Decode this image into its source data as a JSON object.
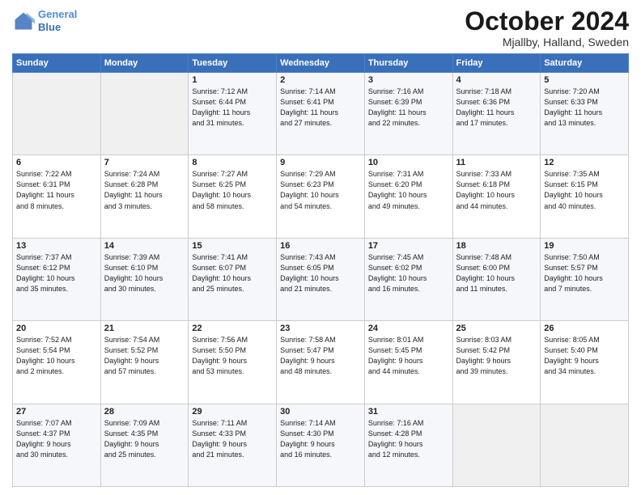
{
  "header": {
    "logo_line1": "General",
    "logo_line2": "Blue",
    "month_title": "October 2024",
    "location": "Mjallby, Halland, Sweden"
  },
  "days_of_week": [
    "Sunday",
    "Monday",
    "Tuesday",
    "Wednesday",
    "Thursday",
    "Friday",
    "Saturday"
  ],
  "weeks": [
    [
      {
        "num": "",
        "info": ""
      },
      {
        "num": "",
        "info": ""
      },
      {
        "num": "1",
        "info": "Sunrise: 7:12 AM\nSunset: 6:44 PM\nDaylight: 11 hours\nand 31 minutes."
      },
      {
        "num": "2",
        "info": "Sunrise: 7:14 AM\nSunset: 6:41 PM\nDaylight: 11 hours\nand 27 minutes."
      },
      {
        "num": "3",
        "info": "Sunrise: 7:16 AM\nSunset: 6:39 PM\nDaylight: 11 hours\nand 22 minutes."
      },
      {
        "num": "4",
        "info": "Sunrise: 7:18 AM\nSunset: 6:36 PM\nDaylight: 11 hours\nand 17 minutes."
      },
      {
        "num": "5",
        "info": "Sunrise: 7:20 AM\nSunset: 6:33 PM\nDaylight: 11 hours\nand 13 minutes."
      }
    ],
    [
      {
        "num": "6",
        "info": "Sunrise: 7:22 AM\nSunset: 6:31 PM\nDaylight: 11 hours\nand 8 minutes."
      },
      {
        "num": "7",
        "info": "Sunrise: 7:24 AM\nSunset: 6:28 PM\nDaylight: 11 hours\nand 3 minutes."
      },
      {
        "num": "8",
        "info": "Sunrise: 7:27 AM\nSunset: 6:25 PM\nDaylight: 10 hours\nand 58 minutes."
      },
      {
        "num": "9",
        "info": "Sunrise: 7:29 AM\nSunset: 6:23 PM\nDaylight: 10 hours\nand 54 minutes."
      },
      {
        "num": "10",
        "info": "Sunrise: 7:31 AM\nSunset: 6:20 PM\nDaylight: 10 hours\nand 49 minutes."
      },
      {
        "num": "11",
        "info": "Sunrise: 7:33 AM\nSunset: 6:18 PM\nDaylight: 10 hours\nand 44 minutes."
      },
      {
        "num": "12",
        "info": "Sunrise: 7:35 AM\nSunset: 6:15 PM\nDaylight: 10 hours\nand 40 minutes."
      }
    ],
    [
      {
        "num": "13",
        "info": "Sunrise: 7:37 AM\nSunset: 6:12 PM\nDaylight: 10 hours\nand 35 minutes."
      },
      {
        "num": "14",
        "info": "Sunrise: 7:39 AM\nSunset: 6:10 PM\nDaylight: 10 hours\nand 30 minutes."
      },
      {
        "num": "15",
        "info": "Sunrise: 7:41 AM\nSunset: 6:07 PM\nDaylight: 10 hours\nand 25 minutes."
      },
      {
        "num": "16",
        "info": "Sunrise: 7:43 AM\nSunset: 6:05 PM\nDaylight: 10 hours\nand 21 minutes."
      },
      {
        "num": "17",
        "info": "Sunrise: 7:45 AM\nSunset: 6:02 PM\nDaylight: 10 hours\nand 16 minutes."
      },
      {
        "num": "18",
        "info": "Sunrise: 7:48 AM\nSunset: 6:00 PM\nDaylight: 10 hours\nand 11 minutes."
      },
      {
        "num": "19",
        "info": "Sunrise: 7:50 AM\nSunset: 5:57 PM\nDaylight: 10 hours\nand 7 minutes."
      }
    ],
    [
      {
        "num": "20",
        "info": "Sunrise: 7:52 AM\nSunset: 5:54 PM\nDaylight: 10 hours\nand 2 minutes."
      },
      {
        "num": "21",
        "info": "Sunrise: 7:54 AM\nSunset: 5:52 PM\nDaylight: 9 hours\nand 57 minutes."
      },
      {
        "num": "22",
        "info": "Sunrise: 7:56 AM\nSunset: 5:50 PM\nDaylight: 9 hours\nand 53 minutes."
      },
      {
        "num": "23",
        "info": "Sunrise: 7:58 AM\nSunset: 5:47 PM\nDaylight: 9 hours\nand 48 minutes."
      },
      {
        "num": "24",
        "info": "Sunrise: 8:01 AM\nSunset: 5:45 PM\nDaylight: 9 hours\nand 44 minutes."
      },
      {
        "num": "25",
        "info": "Sunrise: 8:03 AM\nSunset: 5:42 PM\nDaylight: 9 hours\nand 39 minutes."
      },
      {
        "num": "26",
        "info": "Sunrise: 8:05 AM\nSunset: 5:40 PM\nDaylight: 9 hours\nand 34 minutes."
      }
    ],
    [
      {
        "num": "27",
        "info": "Sunrise: 7:07 AM\nSunset: 4:37 PM\nDaylight: 9 hours\nand 30 minutes."
      },
      {
        "num": "28",
        "info": "Sunrise: 7:09 AM\nSunset: 4:35 PM\nDaylight: 9 hours\nand 25 minutes."
      },
      {
        "num": "29",
        "info": "Sunrise: 7:11 AM\nSunset: 4:33 PM\nDaylight: 9 hours\nand 21 minutes."
      },
      {
        "num": "30",
        "info": "Sunrise: 7:14 AM\nSunset: 4:30 PM\nDaylight: 9 hours\nand 16 minutes."
      },
      {
        "num": "31",
        "info": "Sunrise: 7:16 AM\nSunset: 4:28 PM\nDaylight: 9 hours\nand 12 minutes."
      },
      {
        "num": "",
        "info": ""
      },
      {
        "num": "",
        "info": ""
      }
    ]
  ]
}
